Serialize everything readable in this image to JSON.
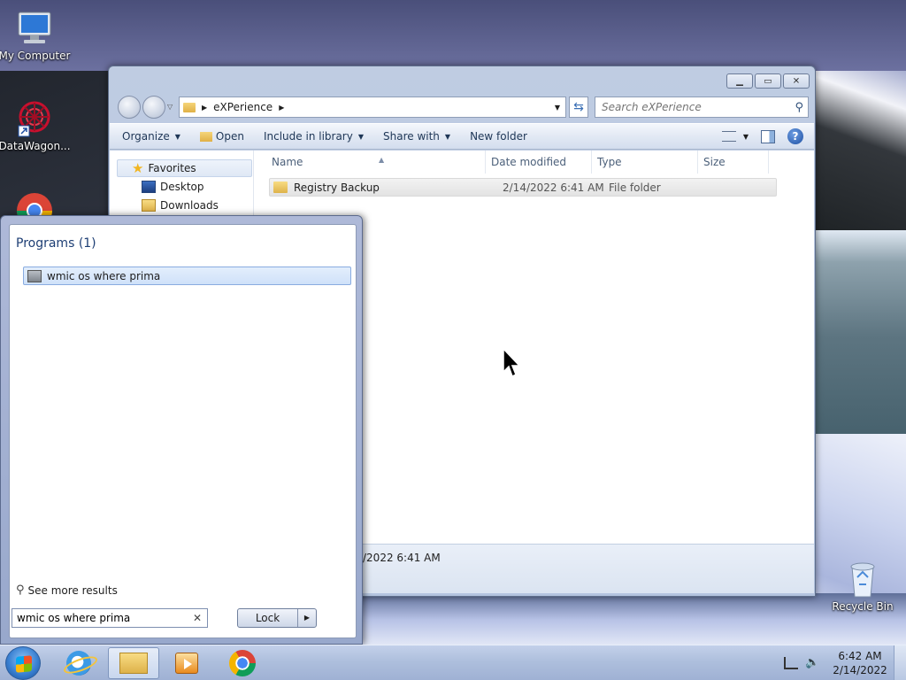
{
  "desktop": {
    "icons": [
      {
        "label": "My Computer",
        "icon": "computer-icon"
      },
      {
        "label": "DataWagon...",
        "icon": "datawagon-icon"
      },
      {
        "label": "",
        "icon": "chrome-icon"
      },
      {
        "label": "Recycle Bin",
        "icon": "recycle-bin-icon"
      }
    ]
  },
  "explorer": {
    "breadcrumb": [
      "eXPerience"
    ],
    "search_placeholder": "Search eXPerience",
    "toolbar": {
      "organize": "Organize",
      "open": "Open",
      "include_in_library": "Include in library",
      "share_with": "Share with",
      "new_folder": "New folder"
    },
    "nav": {
      "favorites": "Favorites",
      "desktop": "Desktop",
      "downloads": "Downloads"
    },
    "columns": {
      "name": "Name",
      "date_modified": "Date modified",
      "type": "Type",
      "size": "Size"
    },
    "files": [
      {
        "name": "Registry Backup",
        "date_modified": "2/14/2022 6:41 AM",
        "type": "File folder",
        "size": ""
      }
    ],
    "details_pane_text": "/2022 6:41 AM"
  },
  "start_menu": {
    "group_header": "Programs (1)",
    "results": [
      {
        "label": "wmic os where prima",
        "icon": "cmd-icon"
      }
    ],
    "see_more": "See more results",
    "search_value": "wmic os where prima",
    "lock_label": "Lock"
  },
  "taskbar": {
    "pinned": [
      "internet-explorer",
      "windows-explorer",
      "windows-media-player",
      "chrome"
    ],
    "active": "windows-explorer",
    "clock_time": "6:42 AM",
    "clock_date": "2/14/2022"
  },
  "colors": {
    "taskbar": "#aebfdd",
    "selection": "#cfe1f9",
    "link_text": "#1d3e74"
  }
}
